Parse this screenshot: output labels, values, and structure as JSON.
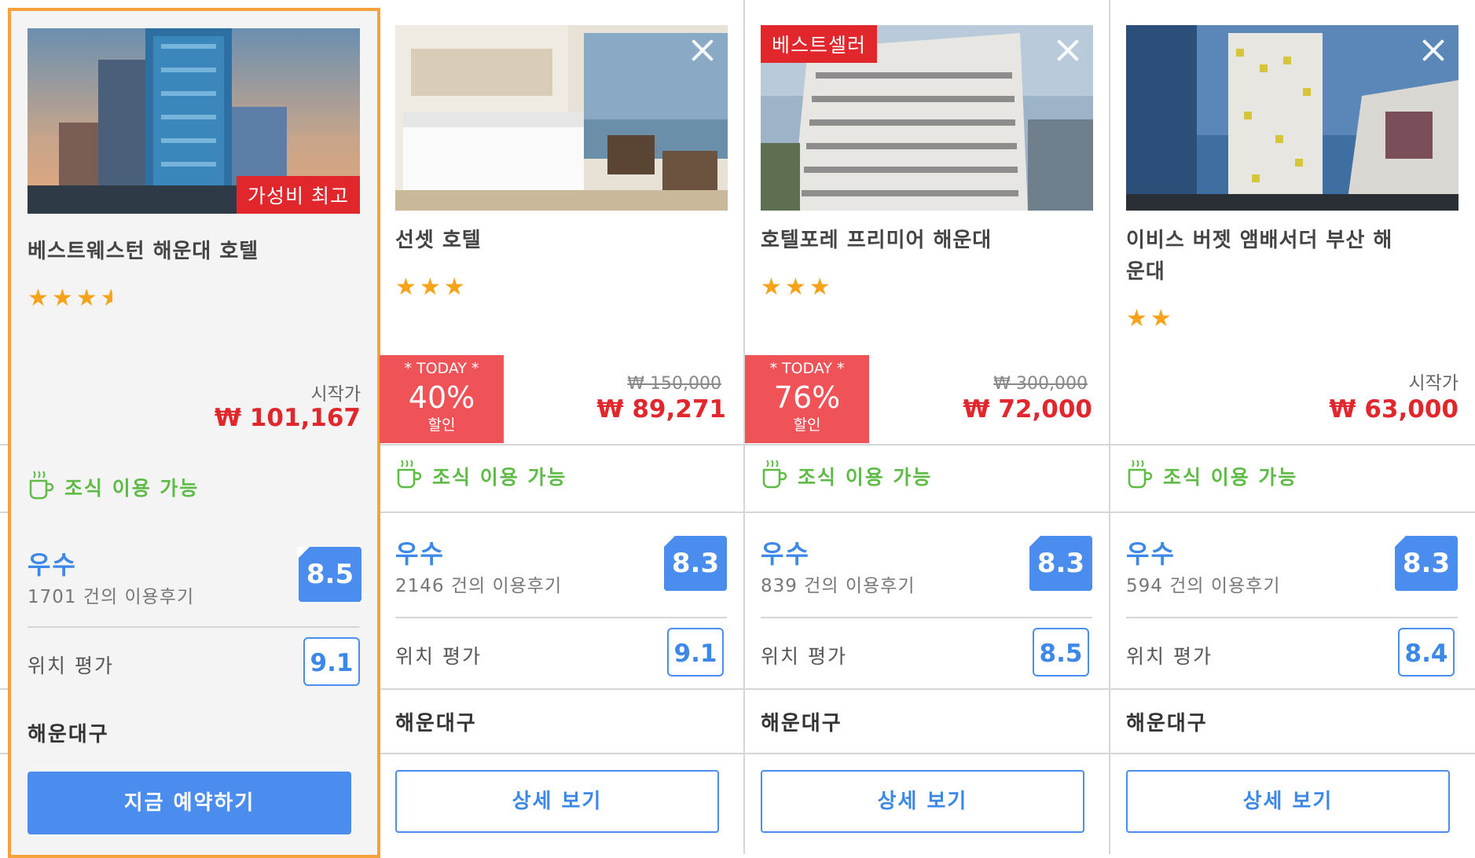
{
  "hotels": [
    {
      "name": "베스트웨스턴 해운대 호텔",
      "badge": "가성비 최고",
      "stars": "3.5",
      "price_label": "시작가",
      "price": "₩ 101,167",
      "breakfast": "조식 이용 가능",
      "grade": "우수",
      "reviews": "1701 건의 이용후기",
      "score": "8.5",
      "location_label": "위치 평가",
      "location_score": "9.1",
      "district": "해운대구",
      "button": "지금 예약하기"
    },
    {
      "name": "선셋 호텔",
      "stars": "3",
      "deal_label": "* TODAY *",
      "discount": "40%",
      "discount_suffix": "할인",
      "old_price": "₩ 150,000",
      "price": "₩ 89,271",
      "breakfast": "조식 이용 가능",
      "grade": "우수",
      "reviews": "2146 건의 이용후기",
      "score": "8.3",
      "location_label": "위치 평가",
      "location_score": "9.1",
      "district": "해운대구",
      "button": "상세 보기"
    },
    {
      "name": "호텔포레 프리미어 해운대",
      "badge": "베스트셀러",
      "stars": "3",
      "deal_label": "* TODAY *",
      "discount": "76%",
      "discount_suffix": "할인",
      "old_price": "₩ 300,000",
      "price": "₩ 72,000",
      "breakfast": "조식 이용 가능",
      "grade": "우수",
      "reviews": "839 건의 이용후기",
      "score": "8.3",
      "location_label": "위치 평가",
      "location_score": "8.5",
      "district": "해운대구",
      "button": "상세 보기"
    },
    {
      "name_line1": "이비스 버젯 앰배서더 부산 해",
      "name_line2": "운대",
      "stars": "2",
      "price_label": "시작가",
      "price": "₩ 63,000",
      "breakfast": "조식 이용 가능",
      "grade": "우수",
      "reviews": "594 건의 이용후기",
      "score": "8.3",
      "location_label": "위치 평가",
      "location_score": "8.4",
      "district": "해운대구",
      "button": "상세 보기"
    }
  ],
  "colors": {
    "accent": "#4a8def",
    "price": "#e1262c",
    "deal": "#ef5358",
    "breakfast": "#5dbb46",
    "featured_border": "#f5a23c",
    "stars": "#f7a21b"
  }
}
